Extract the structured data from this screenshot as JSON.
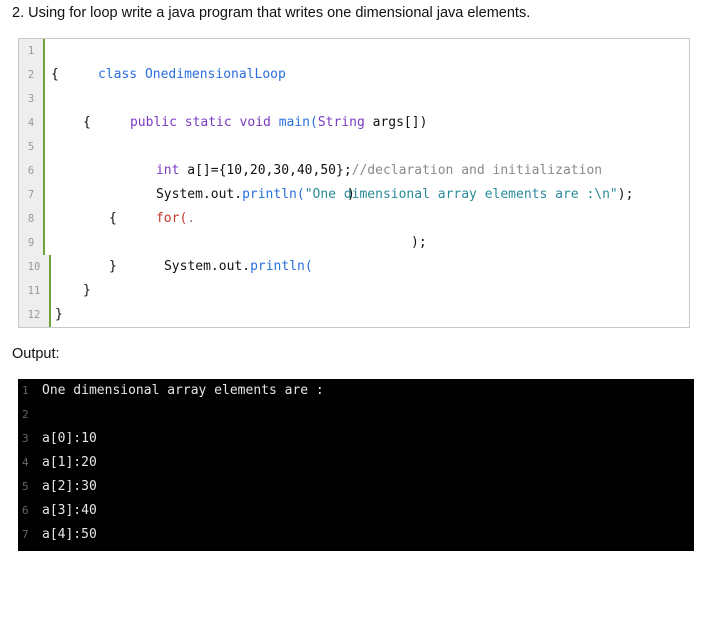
{
  "question": "2. Using for loop write a java program that writes one dimensional java elements.",
  "code_lines": [
    {
      "num": "1"
    },
    {
      "num": "2"
    },
    {
      "num": "3"
    },
    {
      "num": "4"
    },
    {
      "num": "5"
    },
    {
      "num": "6"
    },
    {
      "num": "7"
    },
    {
      "num": "8"
    },
    {
      "num": "9"
    },
    {
      "num": "10"
    },
    {
      "num": "11"
    },
    {
      "num": "12"
    }
  ],
  "code": {
    "l1_kw": "class",
    "l1_name": "OnedimensionalLoop",
    "l2_brace": "{",
    "l3_kw": "public static void",
    "l3_main": "main(",
    "l3_type": "String",
    "l3_args": " args[])",
    "l4_brace": "{",
    "l5_kw": "int",
    "l5_decl": " a[]={10,20,30,40,50};",
    "l5_comment": "//declaration and initialization",
    "l6_sys": "System.out.",
    "l6_method": "println(",
    "l6_str": "\"One dimensional array elements are :\\n\"",
    "l6_end": ");",
    "l7_kw": "for(",
    "l7_dot": ".",
    "l7_close": ")",
    "l8_brace": "{",
    "l9_sys": "System.out.",
    "l9_method": "println(",
    "l9_end": ");",
    "l10_brace": "}",
    "l11_brace": "}",
    "l12_brace": "}"
  },
  "output_label": "Output:",
  "console_lines": [
    {
      "num": "1",
      "text": "One dimensional array elements are :"
    },
    {
      "num": "2",
      "text": ""
    },
    {
      "num": "3",
      "text": "a[0]:10"
    },
    {
      "num": "4",
      "text": "a[1]:20"
    },
    {
      "num": "5",
      "text": "a[2]:30"
    },
    {
      "num": "6",
      "text": "a[3]:40"
    },
    {
      "num": "7",
      "text": "a[4]:50"
    }
  ]
}
